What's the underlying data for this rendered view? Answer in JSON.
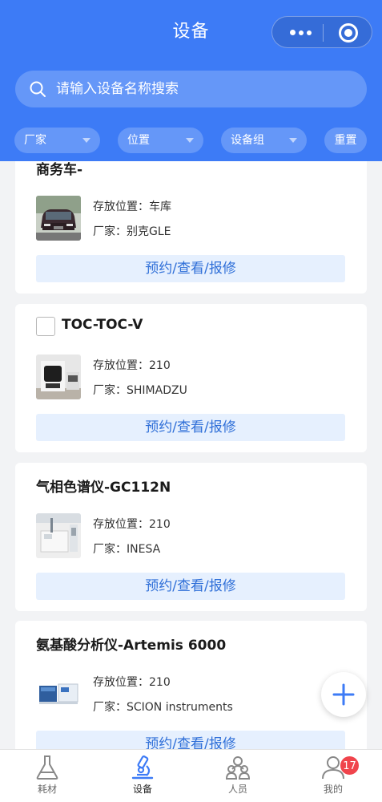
{
  "nav": {
    "title": "设备"
  },
  "search": {
    "placeholder": "请输入设备名称搜索"
  },
  "filters": [
    {
      "label": "厂家"
    },
    {
      "label": "位置"
    },
    {
      "label": "设备组"
    },
    {
      "label": "重置"
    }
  ],
  "devices": [
    {
      "title": "商务车-",
      "location_label": "存放位置：车库",
      "vendor_label": "厂家：别克GLE",
      "action": "预约/查看/报修",
      "thumb_icon": "car-photo"
    },
    {
      "title": "TOC-TOC-V",
      "location_label": "存放位置：210",
      "vendor_label": "厂家：SHIMADZU",
      "action": "预约/查看/报修",
      "thumb_icon": "toc-analyzer-photo"
    },
    {
      "title": "气相色谱仪-GC112N",
      "location_label": "存放位置：210",
      "vendor_label": "厂家：INESA",
      "action": "预约/查看/报修",
      "thumb_icon": "gas-chromatograph-photo"
    },
    {
      "title": "氨基酸分析仪-Artemis 6000",
      "location_label": "存放位置：210",
      "vendor_label": "厂家：SCION instruments",
      "action": "预约/查看/报修",
      "thumb_icon": "amino-acid-analyzer-photo"
    }
  ],
  "tabs": [
    {
      "label": "耗材",
      "icon": "flask-icon"
    },
    {
      "label": "设备",
      "icon": "microscope-icon",
      "active": true
    },
    {
      "label": "人员",
      "icon": "people-icon"
    },
    {
      "label": "我的",
      "icon": "user-icon",
      "badge": "17"
    }
  ],
  "colors": {
    "primary": "#3d7bf6",
    "action_bg": "#e6f0fe",
    "action_text": "#2f6fd8",
    "badge": "#f0444c"
  }
}
